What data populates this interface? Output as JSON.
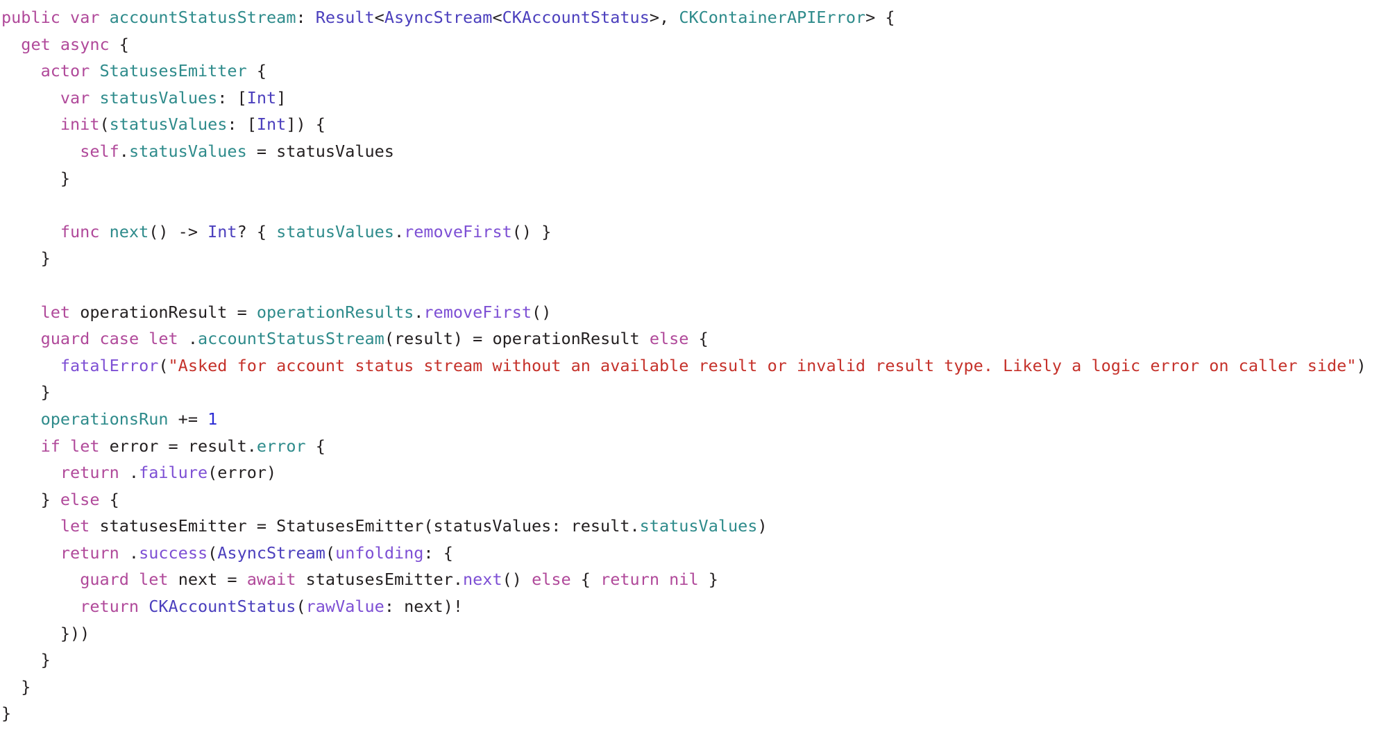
{
  "editor": {
    "language": "Swift",
    "background_color": "#ffffff",
    "font_size_px": 23.5,
    "line_height_px": 38.6,
    "palette": {
      "keyword": "#b0499a",
      "type": "#4b3fbd",
      "identifier": "#2e8b8b",
      "function": "#7d4fd4",
      "string": "#c5312a",
      "number": "#2b2bd4",
      "plain": "#231f20",
      "background": "#ffffff"
    }
  },
  "code": {
    "lines": [
      {
        "index": 1,
        "text": "public var accountStatusStream: Result<AsyncStream<CKAccountStatus>, CKContainerAPIError> {",
        "tokens": [
          {
            "t": "public",
            "c": "t-kw"
          },
          {
            "t": " ",
            "c": "t-pl"
          },
          {
            "t": "var",
            "c": "t-kw"
          },
          {
            "t": " ",
            "c": "t-pl"
          },
          {
            "t": "accountStatusStream",
            "c": "t-id"
          },
          {
            "t": ": ",
            "c": "t-pl"
          },
          {
            "t": "Result",
            "c": "t-type"
          },
          {
            "t": "<",
            "c": "t-pl"
          },
          {
            "t": "AsyncStream",
            "c": "t-type"
          },
          {
            "t": "<",
            "c": "t-pl"
          },
          {
            "t": "CKAccountStatus",
            "c": "t-type"
          },
          {
            "t": ">, ",
            "c": "t-pl"
          },
          {
            "t": "CKContainerAPIError",
            "c": "t-id"
          },
          {
            "t": "> {",
            "c": "t-pl"
          }
        ]
      },
      {
        "index": 2,
        "text": "  get async {",
        "tokens": [
          {
            "t": "  ",
            "c": "t-pl"
          },
          {
            "t": "get",
            "c": "t-kw"
          },
          {
            "t": " ",
            "c": "t-pl"
          },
          {
            "t": "async",
            "c": "t-kw"
          },
          {
            "t": " {",
            "c": "t-pl"
          }
        ]
      },
      {
        "index": 3,
        "text": "    actor StatusesEmitter {",
        "tokens": [
          {
            "t": "    ",
            "c": "t-pl"
          },
          {
            "t": "actor",
            "c": "t-kw"
          },
          {
            "t": " ",
            "c": "t-pl"
          },
          {
            "t": "StatusesEmitter",
            "c": "t-id"
          },
          {
            "t": " {",
            "c": "t-pl"
          }
        ]
      },
      {
        "index": 4,
        "text": "      var statusValues: [Int]",
        "tokens": [
          {
            "t": "      ",
            "c": "t-pl"
          },
          {
            "t": "var",
            "c": "t-kw"
          },
          {
            "t": " ",
            "c": "t-pl"
          },
          {
            "t": "statusValues",
            "c": "t-id"
          },
          {
            "t": ": [",
            "c": "t-pl"
          },
          {
            "t": "Int",
            "c": "t-type"
          },
          {
            "t": "]",
            "c": "t-pl"
          }
        ]
      },
      {
        "index": 5,
        "text": "      init(statusValues: [Int]) {",
        "tokens": [
          {
            "t": "      ",
            "c": "t-pl"
          },
          {
            "t": "init",
            "c": "t-kw"
          },
          {
            "t": "(",
            "c": "t-pl"
          },
          {
            "t": "statusValues",
            "c": "t-id"
          },
          {
            "t": ": [",
            "c": "t-pl"
          },
          {
            "t": "Int",
            "c": "t-type"
          },
          {
            "t": "]) {",
            "c": "t-pl"
          }
        ]
      },
      {
        "index": 6,
        "text": "        self.statusValues = statusValues",
        "tokens": [
          {
            "t": "        ",
            "c": "t-pl"
          },
          {
            "t": "self",
            "c": "t-kw"
          },
          {
            "t": ".",
            "c": "t-pl"
          },
          {
            "t": "statusValues",
            "c": "t-id"
          },
          {
            "t": " = statusValues",
            "c": "t-pl"
          }
        ]
      },
      {
        "index": 7,
        "text": "      }",
        "tokens": [
          {
            "t": "      }",
            "c": "t-pl"
          }
        ]
      },
      {
        "index": 8,
        "text": "",
        "tokens": []
      },
      {
        "index": 9,
        "text": "      func next() -> Int? { statusValues.removeFirst() }",
        "tokens": [
          {
            "t": "      ",
            "c": "t-pl"
          },
          {
            "t": "func",
            "c": "t-kw"
          },
          {
            "t": " ",
            "c": "t-pl"
          },
          {
            "t": "next",
            "c": "t-id"
          },
          {
            "t": "() -> ",
            "c": "t-pl"
          },
          {
            "t": "Int",
            "c": "t-type"
          },
          {
            "t": "? { ",
            "c": "t-pl"
          },
          {
            "t": "statusValues",
            "c": "t-id"
          },
          {
            "t": ".",
            "c": "t-pl"
          },
          {
            "t": "removeFirst",
            "c": "t-fn"
          },
          {
            "t": "() }",
            "c": "t-pl"
          }
        ]
      },
      {
        "index": 10,
        "text": "    }",
        "tokens": [
          {
            "t": "    }",
            "c": "t-pl"
          }
        ]
      },
      {
        "index": 11,
        "text": "",
        "tokens": []
      },
      {
        "index": 12,
        "text": "    let operationResult = operationResults.removeFirst()",
        "tokens": [
          {
            "t": "    ",
            "c": "t-pl"
          },
          {
            "t": "let",
            "c": "t-kw"
          },
          {
            "t": " operationResult = ",
            "c": "t-pl"
          },
          {
            "t": "operationResults",
            "c": "t-id"
          },
          {
            "t": ".",
            "c": "t-pl"
          },
          {
            "t": "removeFirst",
            "c": "t-fn"
          },
          {
            "t": "()",
            "c": "t-pl"
          }
        ]
      },
      {
        "index": 13,
        "text": "    guard case let .accountStatusStream(result) = operationResult else {",
        "tokens": [
          {
            "t": "    ",
            "c": "t-pl"
          },
          {
            "t": "guard",
            "c": "t-kw"
          },
          {
            "t": " ",
            "c": "t-pl"
          },
          {
            "t": "case",
            "c": "t-kw"
          },
          {
            "t": " ",
            "c": "t-pl"
          },
          {
            "t": "let",
            "c": "t-kw"
          },
          {
            "t": " .",
            "c": "t-pl"
          },
          {
            "t": "accountStatusStream",
            "c": "t-id"
          },
          {
            "t": "(result) = operationResult ",
            "c": "t-pl"
          },
          {
            "t": "else",
            "c": "t-kw"
          },
          {
            "t": " {",
            "c": "t-pl"
          }
        ]
      },
      {
        "index": 14,
        "text": "      fatalError(\"Asked for account status stream without an available result or invalid result type. Likely a logic error on caller side\")",
        "tokens": [
          {
            "t": "      ",
            "c": "t-pl"
          },
          {
            "t": "fatalError",
            "c": "t-fn"
          },
          {
            "t": "(",
            "c": "t-pl"
          },
          {
            "t": "\"Asked for account status stream without an available result or invalid result type. Likely a logic error on caller side\"",
            "c": "t-str"
          },
          {
            "t": ")",
            "c": "t-pl"
          }
        ]
      },
      {
        "index": 15,
        "text": "    }",
        "tokens": [
          {
            "t": "    }",
            "c": "t-pl"
          }
        ]
      },
      {
        "index": 16,
        "text": "    operationsRun += 1",
        "tokens": [
          {
            "t": "    ",
            "c": "t-pl"
          },
          {
            "t": "operationsRun",
            "c": "t-id"
          },
          {
            "t": " += ",
            "c": "t-pl"
          },
          {
            "t": "1",
            "c": "t-num"
          }
        ]
      },
      {
        "index": 17,
        "text": "    if let error = result.error {",
        "tokens": [
          {
            "t": "    ",
            "c": "t-pl"
          },
          {
            "t": "if",
            "c": "t-kw"
          },
          {
            "t": " ",
            "c": "t-pl"
          },
          {
            "t": "let",
            "c": "t-kw"
          },
          {
            "t": " error = result.",
            "c": "t-pl"
          },
          {
            "t": "error",
            "c": "t-id"
          },
          {
            "t": " {",
            "c": "t-pl"
          }
        ]
      },
      {
        "index": 18,
        "text": "      return .failure(error)",
        "tokens": [
          {
            "t": "      ",
            "c": "t-pl"
          },
          {
            "t": "return",
            "c": "t-kw"
          },
          {
            "t": " .",
            "c": "t-pl"
          },
          {
            "t": "failure",
            "c": "t-fn"
          },
          {
            "t": "(error)",
            "c": "t-pl"
          }
        ]
      },
      {
        "index": 19,
        "text": "    } else {",
        "tokens": [
          {
            "t": "    } ",
            "c": "t-pl"
          },
          {
            "t": "else",
            "c": "t-kw"
          },
          {
            "t": " {",
            "c": "t-pl"
          }
        ]
      },
      {
        "index": 20,
        "text": "      let statusesEmitter = StatusesEmitter(statusValues: result.statusValues)",
        "tokens": [
          {
            "t": "      ",
            "c": "t-pl"
          },
          {
            "t": "let",
            "c": "t-kw"
          },
          {
            "t": " statusesEmitter = StatusesEmitter(statusValues: result.",
            "c": "t-pl"
          },
          {
            "t": "statusValues",
            "c": "t-id"
          },
          {
            "t": ")",
            "c": "t-pl"
          }
        ]
      },
      {
        "index": 21,
        "text": "      return .success(AsyncStream(unfolding: {",
        "tokens": [
          {
            "t": "      ",
            "c": "t-pl"
          },
          {
            "t": "return",
            "c": "t-kw"
          },
          {
            "t": " .",
            "c": "t-pl"
          },
          {
            "t": "success",
            "c": "t-fn"
          },
          {
            "t": "(",
            "c": "t-pl"
          },
          {
            "t": "AsyncStream",
            "c": "t-type"
          },
          {
            "t": "(",
            "c": "t-pl"
          },
          {
            "t": "unfolding",
            "c": "t-fn"
          },
          {
            "t": ": {",
            "c": "t-pl"
          }
        ]
      },
      {
        "index": 22,
        "text": "        guard let next = await statusesEmitter.next() else { return nil }",
        "tokens": [
          {
            "t": "        ",
            "c": "t-pl"
          },
          {
            "t": "guard",
            "c": "t-kw"
          },
          {
            "t": " ",
            "c": "t-pl"
          },
          {
            "t": "let",
            "c": "t-kw"
          },
          {
            "t": " next = ",
            "c": "t-pl"
          },
          {
            "t": "await",
            "c": "t-kw"
          },
          {
            "t": " statusesEmitter.",
            "c": "t-pl"
          },
          {
            "t": "next",
            "c": "t-fn"
          },
          {
            "t": "() ",
            "c": "t-pl"
          },
          {
            "t": "else",
            "c": "t-kw"
          },
          {
            "t": " { ",
            "c": "t-pl"
          },
          {
            "t": "return",
            "c": "t-kw"
          },
          {
            "t": " ",
            "c": "t-pl"
          },
          {
            "t": "nil",
            "c": "t-kw"
          },
          {
            "t": " }",
            "c": "t-pl"
          }
        ]
      },
      {
        "index": 23,
        "text": "        return CKAccountStatus(rawValue: next)!",
        "tokens": [
          {
            "t": "        ",
            "c": "t-pl"
          },
          {
            "t": "return",
            "c": "t-kw"
          },
          {
            "t": " ",
            "c": "t-pl"
          },
          {
            "t": "CKAccountStatus",
            "c": "t-type"
          },
          {
            "t": "(",
            "c": "t-pl"
          },
          {
            "t": "rawValue",
            "c": "t-fn"
          },
          {
            "t": ": next)!",
            "c": "t-pl"
          }
        ]
      },
      {
        "index": 24,
        "text": "      }))",
        "tokens": [
          {
            "t": "      }))",
            "c": "t-pl"
          }
        ]
      },
      {
        "index": 25,
        "text": "    }",
        "tokens": [
          {
            "t": "    }",
            "c": "t-pl"
          }
        ]
      },
      {
        "index": 26,
        "text": "  }",
        "tokens": [
          {
            "t": "  }",
            "c": "t-pl"
          }
        ]
      },
      {
        "index": 27,
        "text": "}",
        "tokens": [
          {
            "t": "}",
            "c": "t-pl"
          }
        ]
      }
    ]
  }
}
